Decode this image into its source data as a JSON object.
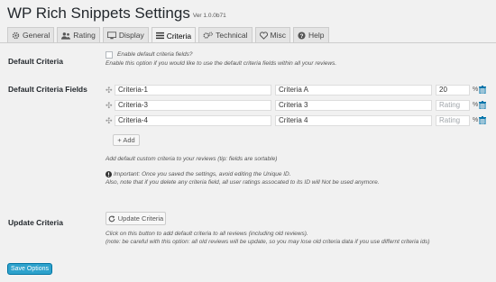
{
  "header": {
    "title": "WP Rich Snippets Settings",
    "version": "Ver 1.0.0b71"
  },
  "tabs": [
    {
      "label": "General",
      "icon": "gear-icon"
    },
    {
      "label": "Rating",
      "icon": "users-icon"
    },
    {
      "label": "Display",
      "icon": "monitor-icon"
    },
    {
      "label": "Criteria",
      "icon": "list-icon",
      "active": true
    },
    {
      "label": "Technical",
      "icon": "gears-icon"
    },
    {
      "label": "Misc",
      "icon": "heart-icon"
    },
    {
      "label": "Help",
      "icon": "help-icon"
    }
  ],
  "default_criteria": {
    "label": "Default Criteria",
    "checkbox_label": "Enable default criteria fields?",
    "description": "Enable this option if you would like to use the default criteria fields within all your reviews."
  },
  "criteria_fields": {
    "label": "Default Criteria Fields",
    "rows": [
      {
        "id": "Criteria-1",
        "name": "Criteria A",
        "rating": "20",
        "rating_placeholder": "Rating"
      },
      {
        "id": "Criteria-3",
        "name": "Criteria 3",
        "rating": "",
        "rating_placeholder": "Rating"
      },
      {
        "id": "Criteria-4",
        "name": "Criteria 4",
        "rating": "",
        "rating_placeholder": "Rating"
      }
    ],
    "percent_symbol": "%",
    "add_button": "+ Add",
    "help_text": "Add default custom criteria to your reviews (tip: fields are sortable)",
    "important": "Important: Once you saved the settings, avoid editing the Unique ID.",
    "note": "Also, note that if you delete any criteria field, all user ratings assocated to its ID will Not be used anymore."
  },
  "update_criteria": {
    "label": "Update Criteria",
    "button": "Update Criteria",
    "line1": "Click on this button to add default criteria to all reviews (including old reviews).",
    "line2": "(note: be careful with this option: all old reviews will be update, so you may lose old criteria data if you use differnt criteria ids)"
  },
  "save_button": "Save Options",
  "colors": {
    "primary": "#2ea2cc",
    "trash": "#0073aa",
    "background": "#f1f1f1"
  }
}
